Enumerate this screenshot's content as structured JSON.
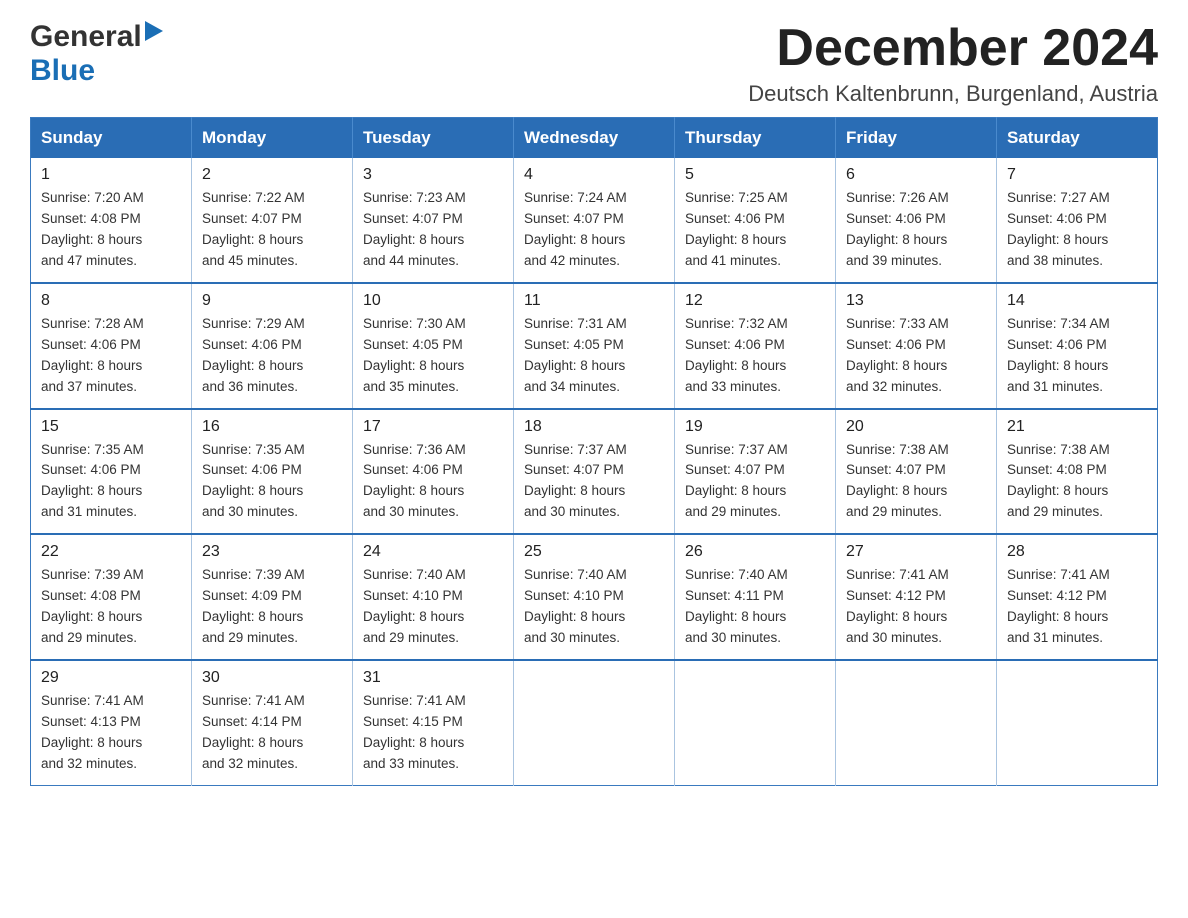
{
  "header": {
    "logo_general": "General",
    "logo_blue": "Blue",
    "month_title": "December 2024",
    "location": "Deutsch Kaltenbrunn, Burgenland, Austria"
  },
  "days_of_week": [
    "Sunday",
    "Monday",
    "Tuesday",
    "Wednesday",
    "Thursday",
    "Friday",
    "Saturday"
  ],
  "weeks": [
    [
      {
        "day": "1",
        "sunrise": "7:20 AM",
        "sunset": "4:08 PM",
        "daylight": "8 hours and 47 minutes."
      },
      {
        "day": "2",
        "sunrise": "7:22 AM",
        "sunset": "4:07 PM",
        "daylight": "8 hours and 45 minutes."
      },
      {
        "day": "3",
        "sunrise": "7:23 AM",
        "sunset": "4:07 PM",
        "daylight": "8 hours and 44 minutes."
      },
      {
        "day": "4",
        "sunrise": "7:24 AM",
        "sunset": "4:07 PM",
        "daylight": "8 hours and 42 minutes."
      },
      {
        "day": "5",
        "sunrise": "7:25 AM",
        "sunset": "4:06 PM",
        "daylight": "8 hours and 41 minutes."
      },
      {
        "day": "6",
        "sunrise": "7:26 AM",
        "sunset": "4:06 PM",
        "daylight": "8 hours and 39 minutes."
      },
      {
        "day": "7",
        "sunrise": "7:27 AM",
        "sunset": "4:06 PM",
        "daylight": "8 hours and 38 minutes."
      }
    ],
    [
      {
        "day": "8",
        "sunrise": "7:28 AM",
        "sunset": "4:06 PM",
        "daylight": "8 hours and 37 minutes."
      },
      {
        "day": "9",
        "sunrise": "7:29 AM",
        "sunset": "4:06 PM",
        "daylight": "8 hours and 36 minutes."
      },
      {
        "day": "10",
        "sunrise": "7:30 AM",
        "sunset": "4:05 PM",
        "daylight": "8 hours and 35 minutes."
      },
      {
        "day": "11",
        "sunrise": "7:31 AM",
        "sunset": "4:05 PM",
        "daylight": "8 hours and 34 minutes."
      },
      {
        "day": "12",
        "sunrise": "7:32 AM",
        "sunset": "4:06 PM",
        "daylight": "8 hours and 33 minutes."
      },
      {
        "day": "13",
        "sunrise": "7:33 AM",
        "sunset": "4:06 PM",
        "daylight": "8 hours and 32 minutes."
      },
      {
        "day": "14",
        "sunrise": "7:34 AM",
        "sunset": "4:06 PM",
        "daylight": "8 hours and 31 minutes."
      }
    ],
    [
      {
        "day": "15",
        "sunrise": "7:35 AM",
        "sunset": "4:06 PM",
        "daylight": "8 hours and 31 minutes."
      },
      {
        "day": "16",
        "sunrise": "7:35 AM",
        "sunset": "4:06 PM",
        "daylight": "8 hours and 30 minutes."
      },
      {
        "day": "17",
        "sunrise": "7:36 AM",
        "sunset": "4:06 PM",
        "daylight": "8 hours and 30 minutes."
      },
      {
        "day": "18",
        "sunrise": "7:37 AM",
        "sunset": "4:07 PM",
        "daylight": "8 hours and 30 minutes."
      },
      {
        "day": "19",
        "sunrise": "7:37 AM",
        "sunset": "4:07 PM",
        "daylight": "8 hours and 29 minutes."
      },
      {
        "day": "20",
        "sunrise": "7:38 AM",
        "sunset": "4:07 PM",
        "daylight": "8 hours and 29 minutes."
      },
      {
        "day": "21",
        "sunrise": "7:38 AM",
        "sunset": "4:08 PM",
        "daylight": "8 hours and 29 minutes."
      }
    ],
    [
      {
        "day": "22",
        "sunrise": "7:39 AM",
        "sunset": "4:08 PM",
        "daylight": "8 hours and 29 minutes."
      },
      {
        "day": "23",
        "sunrise": "7:39 AM",
        "sunset": "4:09 PM",
        "daylight": "8 hours and 29 minutes."
      },
      {
        "day": "24",
        "sunrise": "7:40 AM",
        "sunset": "4:10 PM",
        "daylight": "8 hours and 29 minutes."
      },
      {
        "day": "25",
        "sunrise": "7:40 AM",
        "sunset": "4:10 PM",
        "daylight": "8 hours and 30 minutes."
      },
      {
        "day": "26",
        "sunrise": "7:40 AM",
        "sunset": "4:11 PM",
        "daylight": "8 hours and 30 minutes."
      },
      {
        "day": "27",
        "sunrise": "7:41 AM",
        "sunset": "4:12 PM",
        "daylight": "8 hours and 30 minutes."
      },
      {
        "day": "28",
        "sunrise": "7:41 AM",
        "sunset": "4:12 PM",
        "daylight": "8 hours and 31 minutes."
      }
    ],
    [
      {
        "day": "29",
        "sunrise": "7:41 AM",
        "sunset": "4:13 PM",
        "daylight": "8 hours and 32 minutes."
      },
      {
        "day": "30",
        "sunrise": "7:41 AM",
        "sunset": "4:14 PM",
        "daylight": "8 hours and 32 minutes."
      },
      {
        "day": "31",
        "sunrise": "7:41 AM",
        "sunset": "4:15 PM",
        "daylight": "8 hours and 33 minutes."
      },
      null,
      null,
      null,
      null
    ]
  ],
  "labels": {
    "sunrise": "Sunrise:",
    "sunset": "Sunset:",
    "daylight": "Daylight:"
  }
}
